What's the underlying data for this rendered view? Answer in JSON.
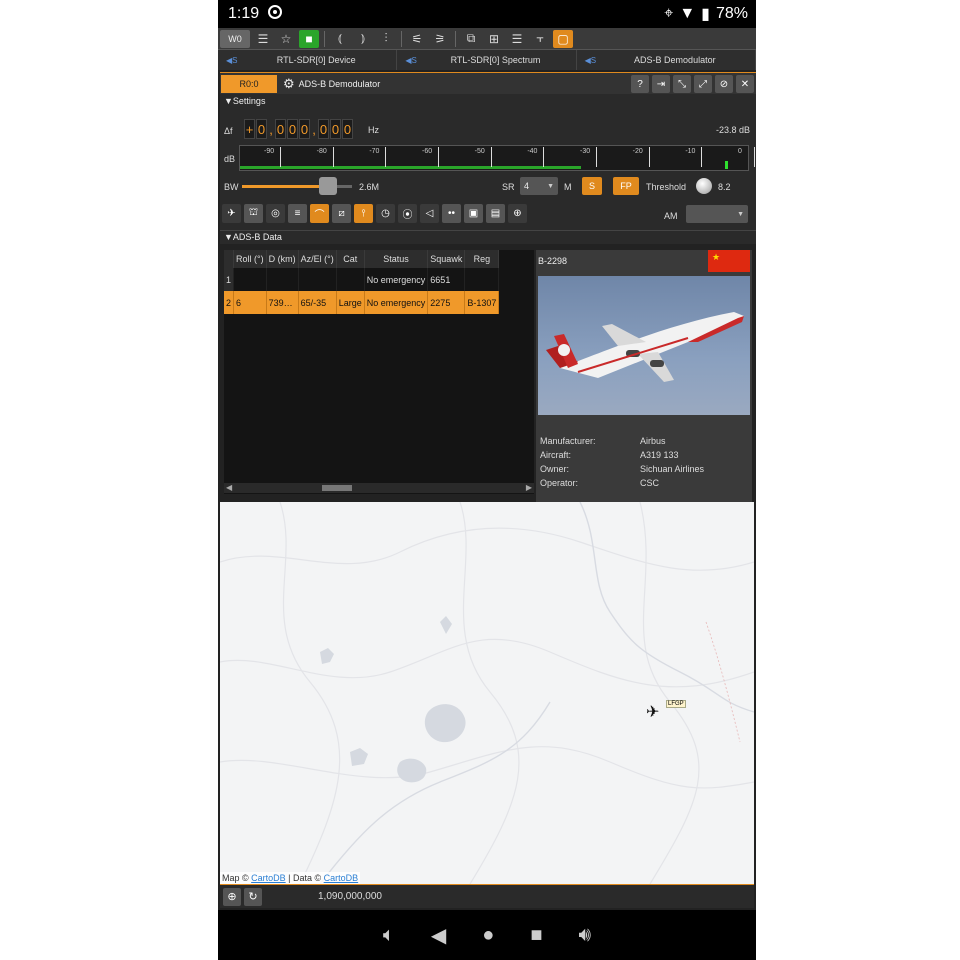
{
  "status": {
    "time": "1:19",
    "battery": "78%"
  },
  "toolbar": {
    "workspace": "W0"
  },
  "tabs": [
    {
      "label": "RTL-SDR[0] Device"
    },
    {
      "label": "RTL-SDR[0] Spectrum"
    },
    {
      "label": "ADS-B Demodulator"
    }
  ],
  "panel": {
    "rx": "R0:0",
    "title": "ADS-B Demodulator"
  },
  "settings": {
    "section": "Settings",
    "delta_label": "Δf",
    "freq_digits": [
      "+",
      "0",
      ",",
      "0",
      "0",
      "0",
      ",",
      "0",
      "0",
      "0"
    ],
    "freq_unit": "Hz",
    "level": "-23.8 dB",
    "db_label": "dB",
    "db_ticks": [
      "-90",
      "-80",
      "-70",
      "-60",
      "-50",
      "-40",
      "-30",
      "-20",
      "-10",
      "0"
    ],
    "bw_label": "BW",
    "bw_value": "2.6M",
    "bw_fraction": 0.78,
    "sr_label": "SR",
    "sr_value": "4",
    "sr_unit": "M",
    "s_button": "S",
    "fp_button": "FP",
    "threshold_label": "Threshold",
    "threshold_value": "8.2",
    "am_label": "AM",
    "am_value": ""
  },
  "adsb": {
    "section": "ADS-B Data",
    "columns": [
      "Roll (°)",
      "D (km)",
      "Az/El (°)",
      "Cat",
      "Status",
      "Squawk",
      "Reg"
    ],
    "rows": [
      {
        "num": "1",
        "cells": [
          "",
          "",
          "",
          "",
          "No emergency",
          "6651",
          ""
        ]
      },
      {
        "num": "2",
        "cells": [
          "6",
          "739…",
          "65/-35",
          "Large",
          "No emergency",
          "2275",
          "B-1307"
        ]
      }
    ],
    "selected_reg": "B-2298",
    "info": [
      {
        "k": "Manufacturer:",
        "v": "Airbus"
      },
      {
        "k": "Aircraft:",
        "v": "A319 133"
      },
      {
        "k": "Owner:",
        "v": "Sichuan Airlines"
      },
      {
        "k": "Operator:",
        "v": "CSC"
      }
    ]
  },
  "map": {
    "attrib_prefix": "Map © ",
    "attrib_link1": "CartoDB",
    "attrib_mid": " | Data © ",
    "attrib_link2": "CartoDB",
    "aircraft_tag": "LFGP",
    "frequency": "1,090,000,000"
  }
}
